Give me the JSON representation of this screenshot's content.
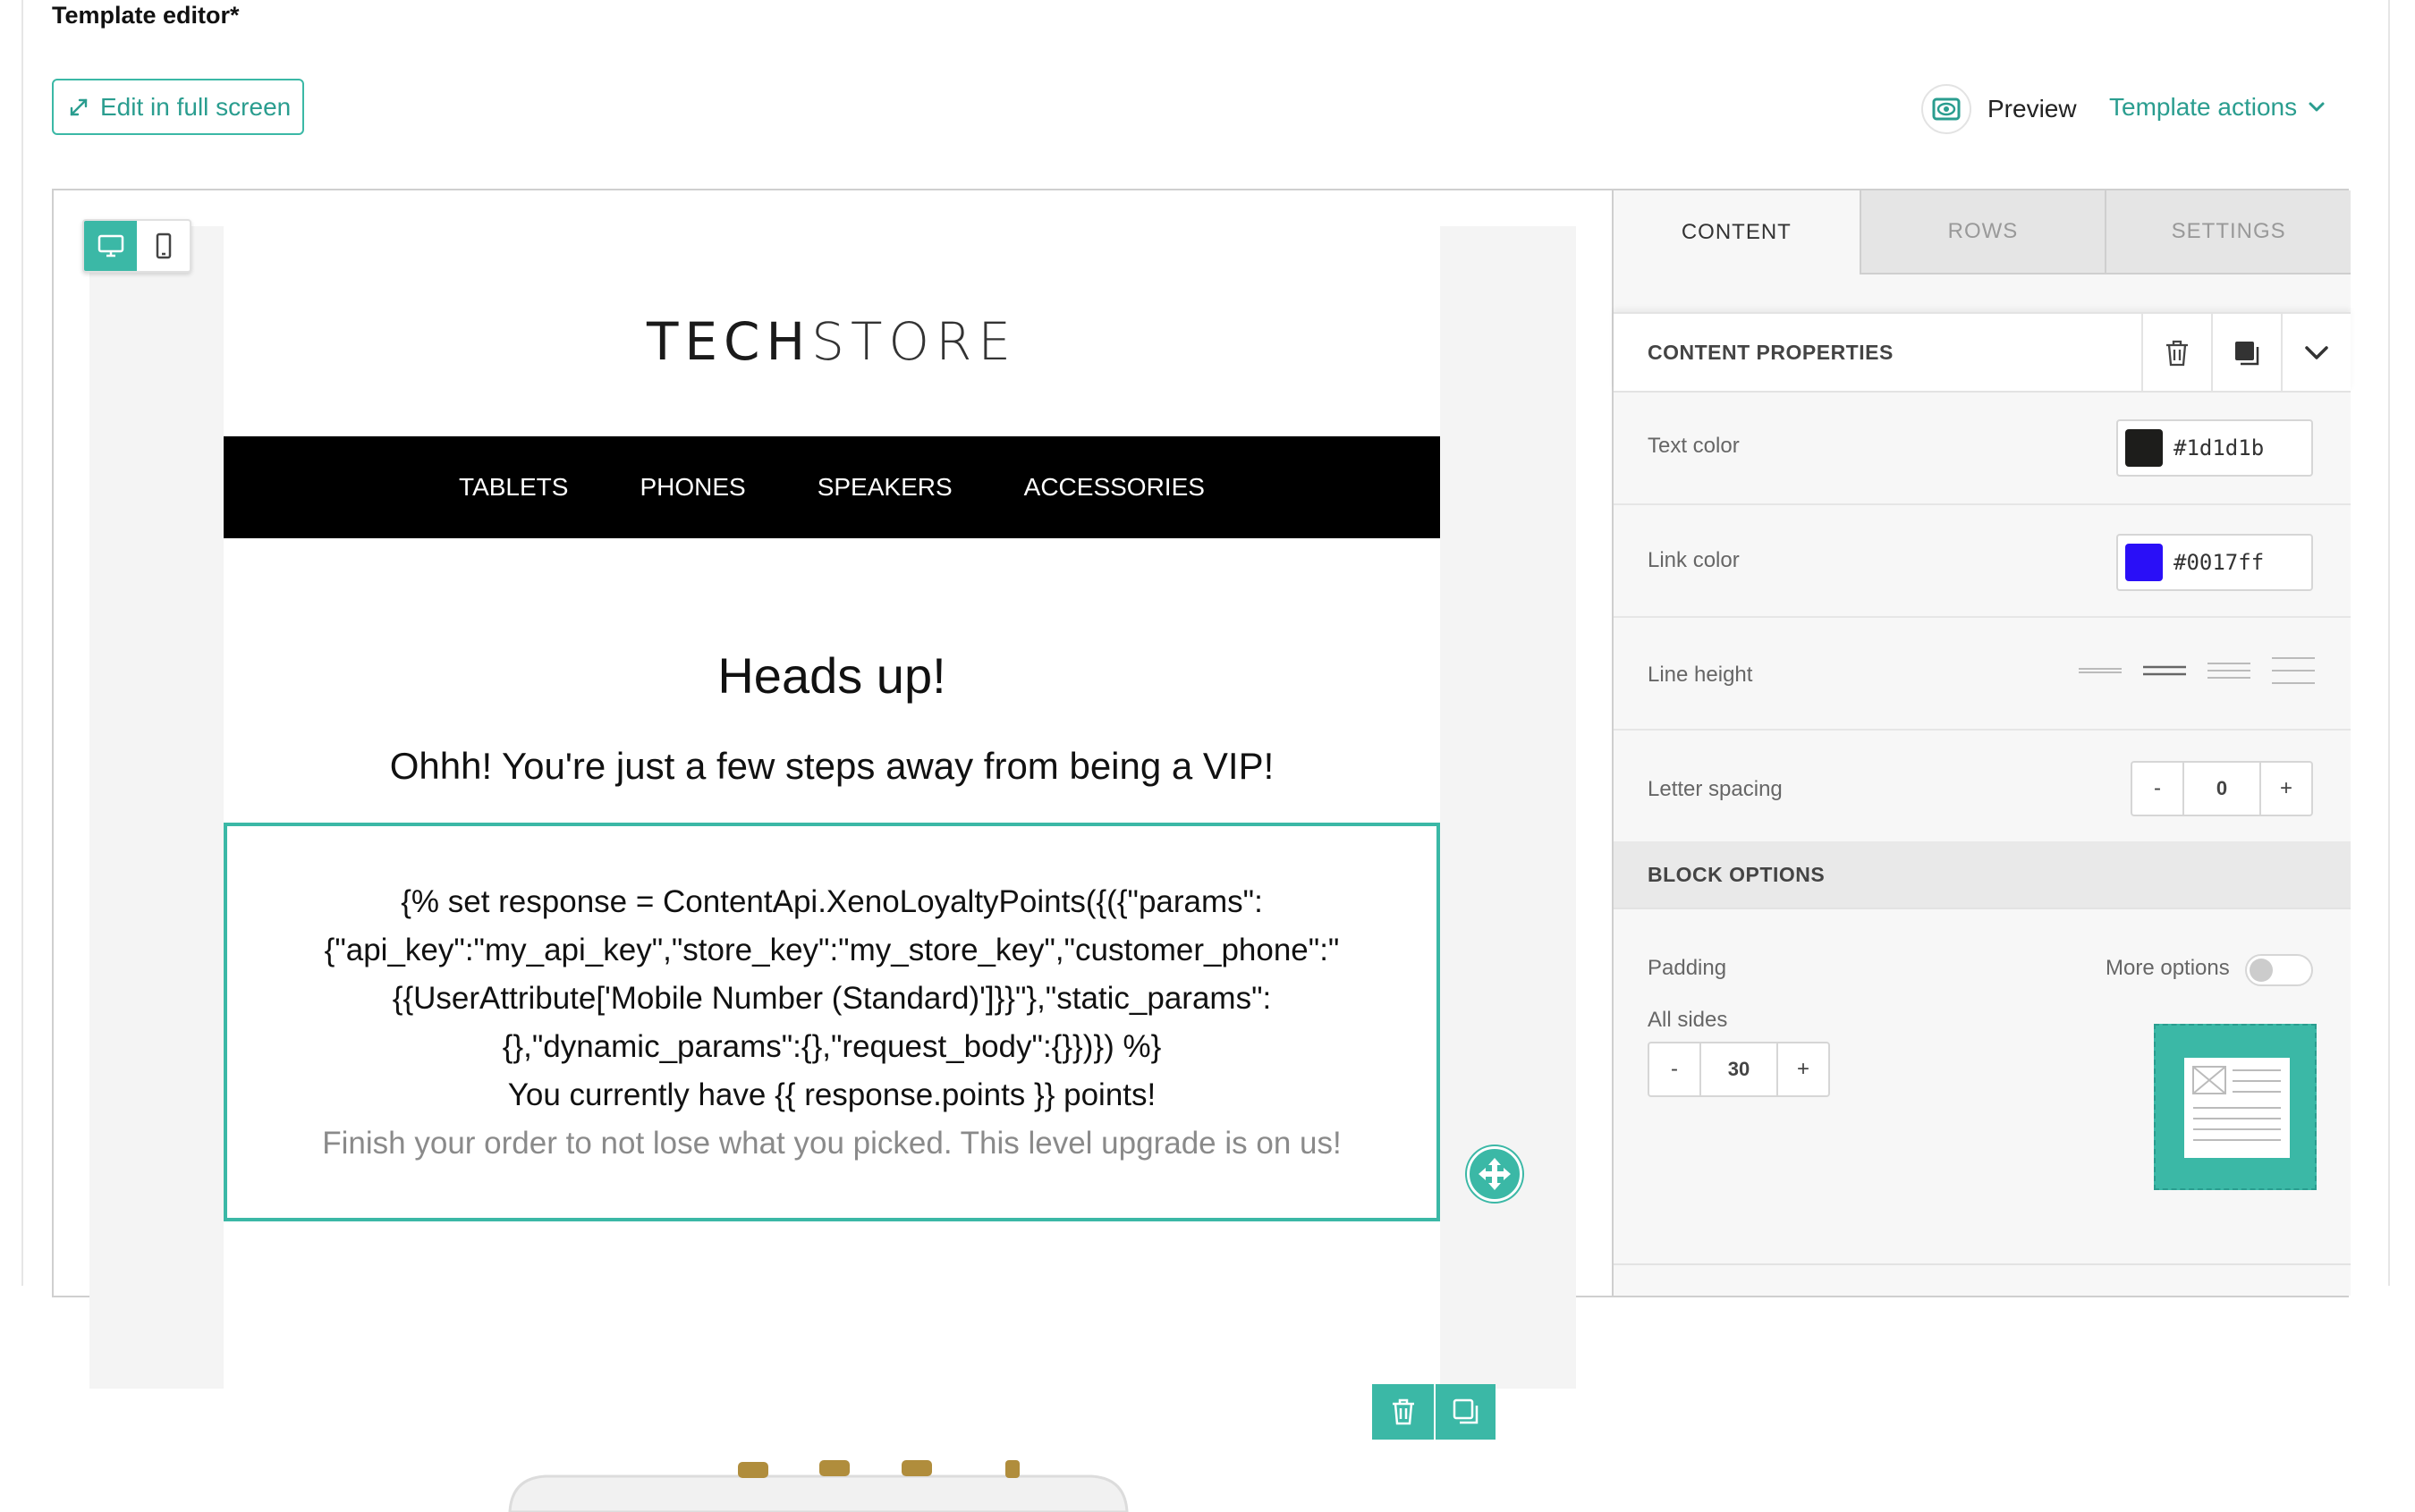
{
  "page": {
    "title": "Template editor*",
    "fullscreen_label": "Edit in full screen",
    "preview_label": "Preview",
    "template_actions_label": "Template actions"
  },
  "email": {
    "logo_bold": "TECH",
    "logo_light": "STORE",
    "nav": [
      "TABLETS",
      "PHONES",
      "SPEAKERS",
      "ACCESSORIES"
    ],
    "heading": "Heads up!",
    "subheading": "Ohhh! You're just a few steps away from being a VIP!",
    "text_lines": [
      "{% set response = ContentApi.XenoLoyaltyPoints({({\"params\":",
      "{\"api_key\":\"my_api_key\",\"store_key\":\"my_store_key\",\"customer_phone\":\"",
      "{{UserAttribute['Mobile Number (Standard)']}}\"},\"static_params\":",
      "{},\"dynamic_params\":{},\"request_body\":{}})}) %}",
      "You currently have {{ response.points }} points!"
    ],
    "muted_line": "Finish your order to not lose what you picked. This level upgrade is on us!"
  },
  "panel": {
    "tabs": [
      "CONTENT",
      "ROWS",
      "SETTINGS"
    ],
    "active_tab": "CONTENT",
    "content_properties_title": "CONTENT PROPERTIES",
    "text_color_label": "Text color",
    "text_color_value": "#1d1d1b",
    "link_color_label": "Link color",
    "link_color_value": "#0017ff",
    "line_height_label": "Line height",
    "letter_spacing_label": "Letter spacing",
    "letter_spacing_value": "0",
    "block_options_title": "BLOCK OPTIONS",
    "padding_label": "Padding",
    "more_options_label": "More options",
    "all_sides_label": "All sides",
    "padding_value": "30",
    "minus": "-",
    "plus": "+"
  },
  "colors": {
    "accent": "#3bb8a6",
    "accent_text": "#2a9d8f",
    "text_swatch": "#1d1d1b",
    "link_swatch": "#2a0ff7"
  }
}
